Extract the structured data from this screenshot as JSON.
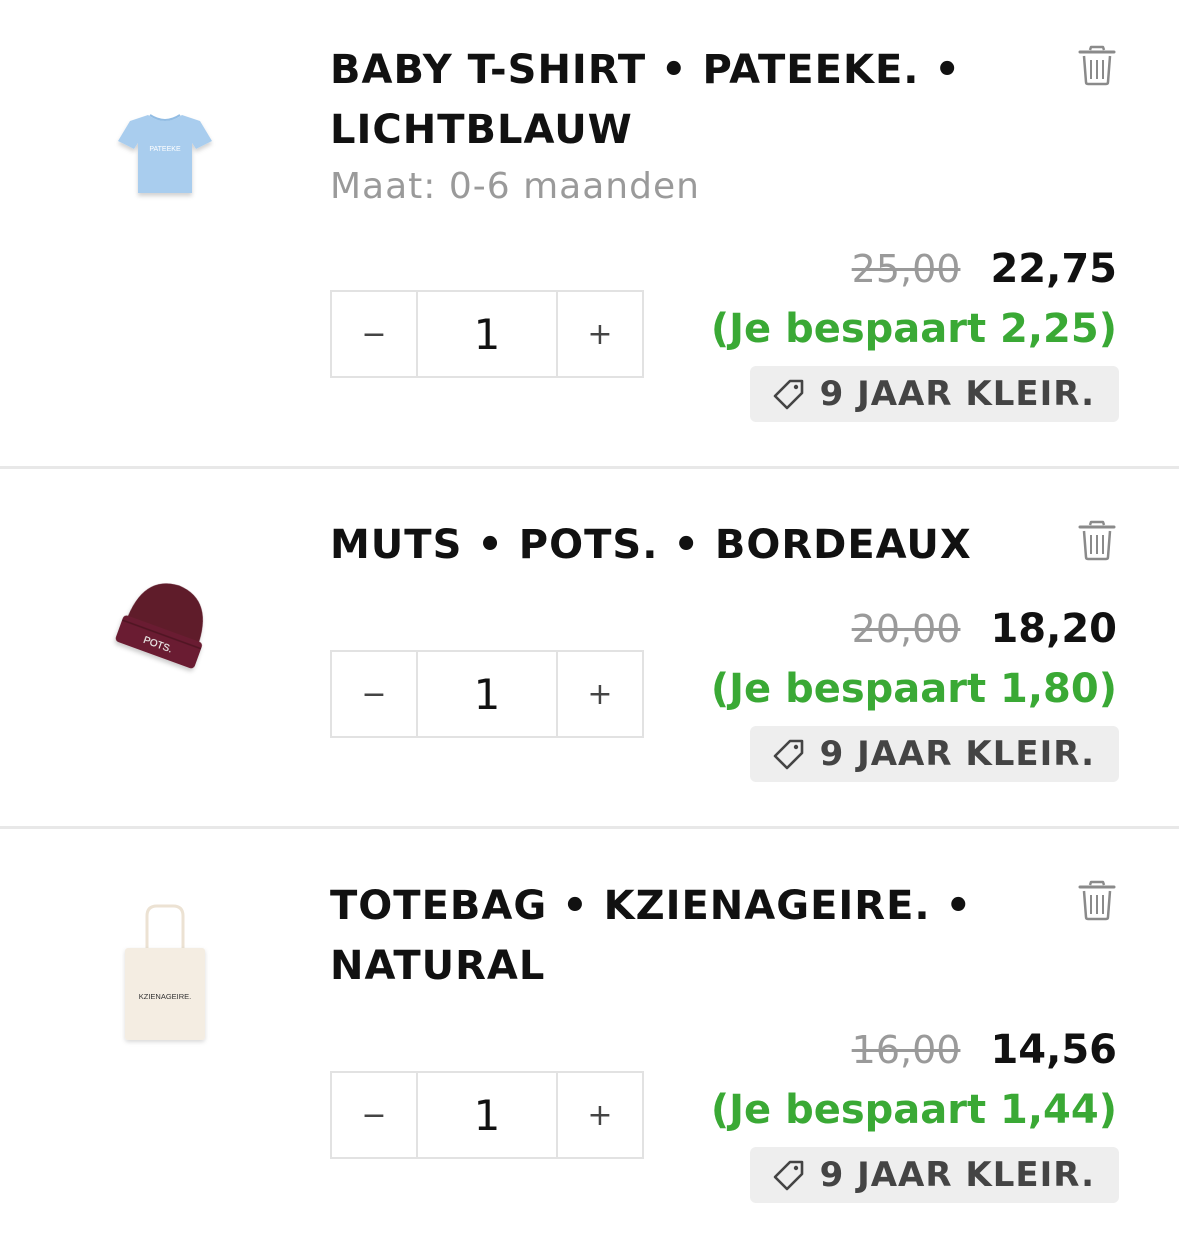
{
  "colors": {
    "savings": "#3aa935",
    "muted": "#9a9a9a",
    "badge_bg": "#eeeeee"
  },
  "icons": {
    "remove": "trash-icon",
    "discount": "tag-icon",
    "decrease": "minus",
    "increase": "plus"
  },
  "cart": {
    "items": [
      {
        "title": "BABY T-SHIRT • PATEEKE. • LICHTBLAUW",
        "variant": "Maat: 0-6 maanden",
        "image_text": "PATEEKE",
        "quantity": "1",
        "minus_label": "−",
        "plus_label": "+",
        "price_old": "25,00",
        "price_new": "22,75",
        "savings": "(Je bespaart 2,25)",
        "discount_label": "9 JAAR KLEIR."
      },
      {
        "title": "MUTS • POTS. • BORDEAUX",
        "variant": "",
        "image_text": "POTS.",
        "quantity": "1",
        "minus_label": "−",
        "plus_label": "+",
        "price_old": "20,00",
        "price_new": "18,20",
        "savings": "(Je bespaart 1,80)",
        "discount_label": "9 JAAR KLEIR."
      },
      {
        "title": "TOTEBAG • KZIENAGEIRE. • NATURAL",
        "variant": "",
        "image_text": "KZIENAGEIRE.",
        "quantity": "1",
        "minus_label": "−",
        "plus_label": "+",
        "price_old": "16,00",
        "price_new": "14,56",
        "savings": "(Je bespaart 1,44)",
        "discount_label": "9 JAAR KLEIR."
      }
    ]
  }
}
